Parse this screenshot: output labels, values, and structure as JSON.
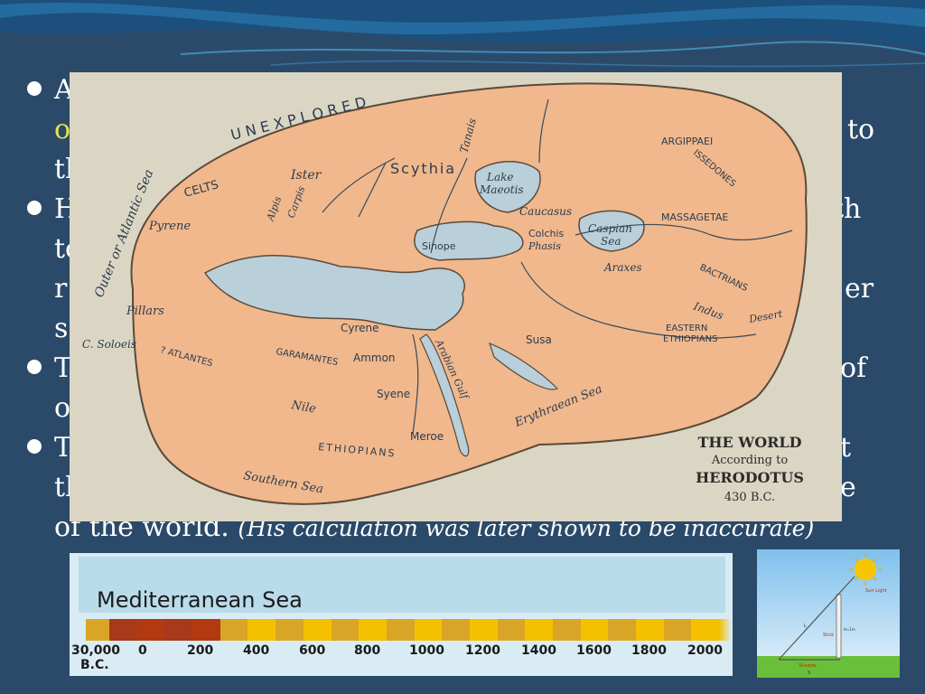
{
  "colors": {
    "background": "#2b4a6a",
    "highlight": "#e3e34a",
    "land": "#f0b88c",
    "water": "#b9cfd9"
  },
  "bullets": [
    {
      "fragments": [
        "A",
        "o",
        "to",
        "th"
      ]
    },
    {
      "fragments": [
        "H",
        "th",
        "to",
        "r",
        "er",
        "s"
      ]
    },
    {
      "fragments": [
        "T",
        "of",
        "o"
      ]
    },
    {
      "fragments": [
        "T",
        "t",
        "th",
        "e"
      ],
      "last_line": "of the world.",
      "note": "(His calculation was later shown to be inaccurate)"
    }
  ],
  "map": {
    "labels": {
      "unexplored": "UNEXPLORED",
      "outer_sea": "Outer or Atlantic Sea",
      "celts": "CELTS",
      "ister": "Ister",
      "scythia": "Scythia",
      "tanais": "Tanais",
      "lake_maeotis_1": "Lake",
      "lake_maeotis_2": "Maeotis",
      "argippaei": "ARGIPPAEI",
      "issedones": "ISSEDONES",
      "pyrene": "Pyrene",
      "alpis": "Alpis",
      "carpis": "Carpis",
      "caucasus": "Caucasus",
      "colchis": "Colchis",
      "phasis": "Phasis",
      "caspian_1": "Caspian",
      "caspian_2": "Sea",
      "massagetae": "MASSAGETAE",
      "sinope": "Sinope",
      "araxes": "Araxes",
      "bactrians": "BACTRIANS",
      "pillars": "Pillars",
      "cyrene": "Cyrene",
      "indus": "Indus",
      "desert": "Desert",
      "c_soloeis": "C. Soloeis",
      "eastern_1": "EASTERN",
      "eastern_2": "ETHIOPIANS",
      "susa": "Susa",
      "ammon": "Ammon",
      "garamantes": "GARAMANTES",
      "atlantes": "? ATLANTES",
      "syene": "Syene",
      "arabian_gulf": "Arabian Gulf",
      "erythraean": "Erythraean Sea",
      "nile": "Nile",
      "meroe": "Meroe",
      "ethiopians": "ETHIOPIANS",
      "southern_sea": "Southern Sea"
    },
    "caption": [
      "THE WORLD",
      "According to",
      "HERODOTUS",
      "430 B.C."
    ]
  },
  "timeline": {
    "title": "Mediterranean Sea",
    "labels": [
      "30,000",
      "0",
      "200",
      "400",
      "600",
      "800",
      "1000",
      "1200",
      "1400",
      "1600",
      "1800",
      "2000"
    ],
    "first_sub": "B.C.",
    "segment_colors": [
      "#d9a526",
      "#a8391a",
      "#b33a10",
      "#a8391a",
      "#b33a10",
      "#d9a526",
      "#f5c000",
      "#d9a526",
      "#f5c000",
      "#d9a526",
      "#f5c000",
      "#d9a526",
      "#f5c000",
      "#d9a526",
      "#f5c000",
      "#d9a526",
      "#f5c000",
      "#d9a526",
      "#f5c000",
      "#d9a526",
      "#f5c000",
      "#d9a526",
      "#f5c000"
    ]
  },
  "diagram": {
    "sun_label": "Sun Light",
    "stick_label": "Stick",
    "shadow_label": "Shadow",
    "length_label": "L",
    "height_label": "H=1m",
    "s_label": "S"
  }
}
